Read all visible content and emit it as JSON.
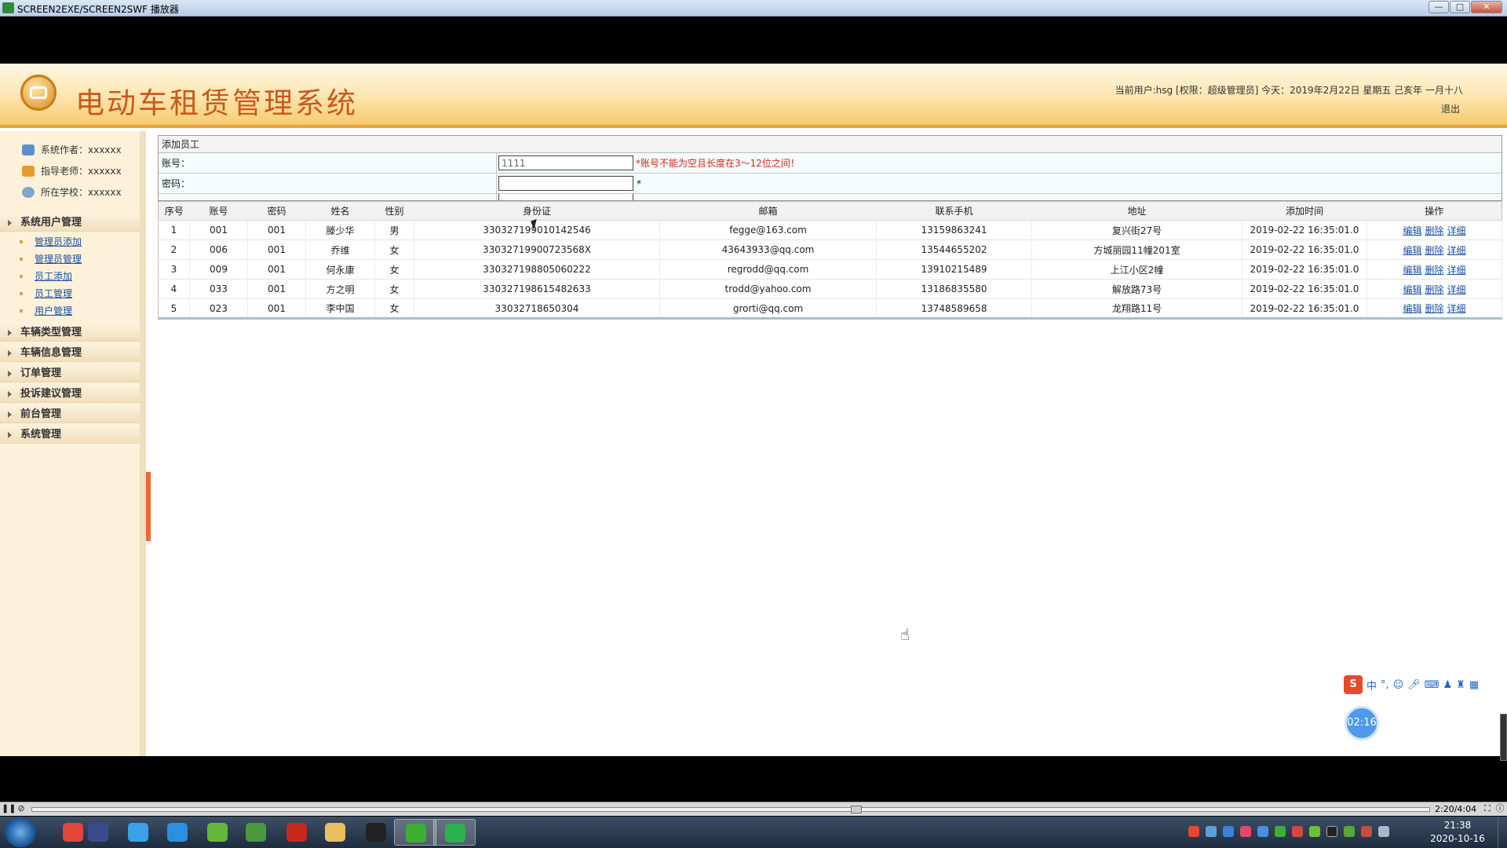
{
  "window": {
    "title": "SCREEN2EXE/SCREEN2SWF 播放器",
    "buttons": [
      "—",
      "□",
      "✕"
    ]
  },
  "header": {
    "app_title": "电动车租赁管理系统",
    "user_info": "当前用户:hsg [权限：超级管理员] 今天：2019年2月22日 星期五 己亥年 一月十八",
    "logout": "退出"
  },
  "sidebar": {
    "info": [
      {
        "text": "系统作者：xxxxxx",
        "icon": "user-group-icon",
        "color": "#5c8fc9"
      },
      {
        "text": "指导老师：xxxxxx",
        "icon": "teacher-icon",
        "color": "#e59b2f"
      },
      {
        "text": "所在学校：xxxxxx",
        "icon": "school-icon",
        "color": "#7fa6cf"
      }
    ],
    "menu": [
      {
        "label": "系统用户管理",
        "items": [
          "管理员添加",
          "管理员管理",
          "员工添加",
          "员工管理",
          "用户管理"
        ]
      },
      {
        "label": "车辆类型管理"
      },
      {
        "label": "车辆信息管理"
      },
      {
        "label": "订单管理"
      },
      {
        "label": "投诉建议管理"
      },
      {
        "label": "前台管理"
      },
      {
        "label": "系统管理"
      }
    ]
  },
  "form": {
    "title": "添加员工",
    "account_label": "账号：",
    "account_value": "1111",
    "account_error": "*账号不能为空且长度在3～12位之间！",
    "password_label": "密码：",
    "password_value": "",
    "password_required": "*"
  },
  "table": {
    "headers": [
      "序号",
      "账号",
      "密码",
      "姓名",
      "性别",
      "身份证",
      "邮箱",
      "联系手机",
      "地址",
      "添加时间",
      "操作"
    ],
    "actions": [
      "编辑",
      "删除",
      "详细"
    ],
    "rows": [
      [
        "1",
        "001",
        "001",
        "滕少华",
        "男",
        "330327199010142546",
        "fegge@163.com",
        "13159863241",
        "复兴街27号",
        "2019-02-22 16:35:01.0"
      ],
      [
        "2",
        "006",
        "001",
        "乔维",
        "女",
        "33032719900723568X",
        "43643933@qq.com",
        "13544655202",
        "方城丽园11幢201室",
        "2019-02-22 16:35:01.0"
      ],
      [
        "3",
        "009",
        "001",
        "何永康",
        "女",
        "330327198805060222",
        "regrodd@qq.com",
        "13910215489",
        "上江小区2幢",
        "2019-02-22 16:35:01.0"
      ],
      [
        "4",
        "033",
        "001",
        "方之明",
        "女",
        "330327198615482633",
        "trodd@yahoo.com",
        "13186835580",
        "解放路73号",
        "2019-02-22 16:35:01.0"
      ],
      [
        "5",
        "023",
        "001",
        "李中国",
        "女",
        "33032718650304",
        "grorti@qq.com",
        "13748589658",
        "龙翔路11号",
        "2019-02-22 16:35:01.0"
      ]
    ]
  },
  "ime": {
    "logo": "S",
    "mode": "中",
    "punct": "°,"
  },
  "timer": "02:16",
  "player": {
    "time": "2:20/4:04",
    "pause": "❚❚",
    "progress": 0.59
  },
  "taskbar": {
    "time": "21:38",
    "date": "2020-10-16",
    "apps": [
      {
        "name": "chrome-icon",
        "color": "#e0463a"
      },
      {
        "name": "terminal-icon",
        "color": "#3b4a8c"
      },
      {
        "name": "baidu-netdisk-icon",
        "color": "#3aa1e8"
      },
      {
        "name": "browser-q-icon",
        "color": "#2a8fe0"
      },
      {
        "name": "leaf-app-icon",
        "color": "#63b83a"
      },
      {
        "name": "spreadsheet-icon",
        "color": "#4b9a3c"
      },
      {
        "name": "flash-icon",
        "color": "#c7281e"
      },
      {
        "name": "folder-icon",
        "color": "#e8c060"
      },
      {
        "name": "qq-icon",
        "color": "#222222"
      },
      {
        "name": "wechat-icon",
        "color": "#3cb034"
      },
      {
        "name": "screen-recorder-icon",
        "color": "#2bb24c"
      }
    ]
  }
}
